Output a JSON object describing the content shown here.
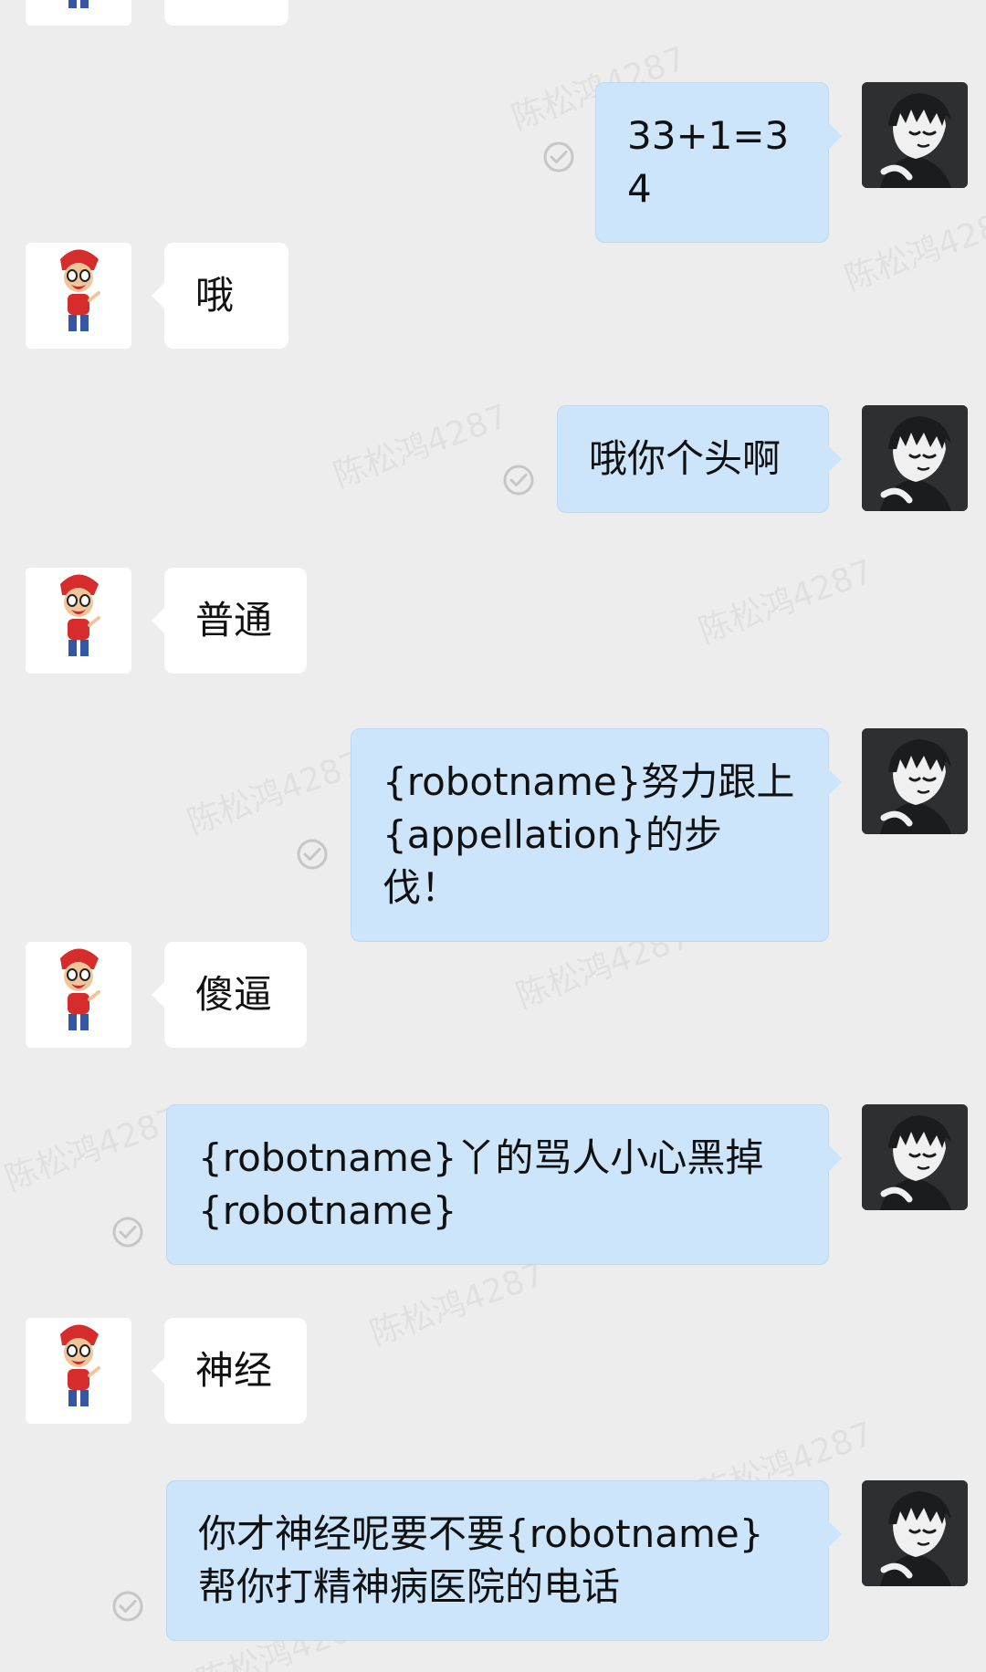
{
  "chat": {
    "watermark_text": "陈松鸿4287",
    "messages": [
      {
        "side": "right",
        "text": "33+1=34",
        "avatar_icon": "boy-avatar-icon",
        "status_icon": "read-check-icon"
      },
      {
        "side": "left",
        "text": "哦",
        "avatar_icon": "cartoon-avatar-icon"
      },
      {
        "side": "right",
        "text": "哦你个头啊",
        "avatar_icon": "boy-avatar-icon",
        "status_icon": "read-check-icon"
      },
      {
        "side": "left",
        "text": "普通",
        "avatar_icon": "cartoon-avatar-icon"
      },
      {
        "side": "right",
        "text": "{robotname}努力跟上\n{appellation}的步伐！",
        "avatar_icon": "boy-avatar-icon",
        "status_icon": "read-check-icon"
      },
      {
        "side": "left",
        "text": "傻逼",
        "avatar_icon": "cartoon-avatar-icon"
      },
      {
        "side": "right",
        "text": "{robotname}丫的骂人小心黑掉\n{robotname}",
        "avatar_icon": "boy-avatar-icon",
        "status_icon": "read-check-icon"
      },
      {
        "side": "left",
        "text": "神经",
        "avatar_icon": "cartoon-avatar-icon"
      },
      {
        "side": "right",
        "text": "你才神经呢要不要{robotname}\n帮你打精神病医院的电话",
        "avatar_icon": "boy-avatar-icon",
        "status_icon": "read-check-icon"
      }
    ]
  }
}
